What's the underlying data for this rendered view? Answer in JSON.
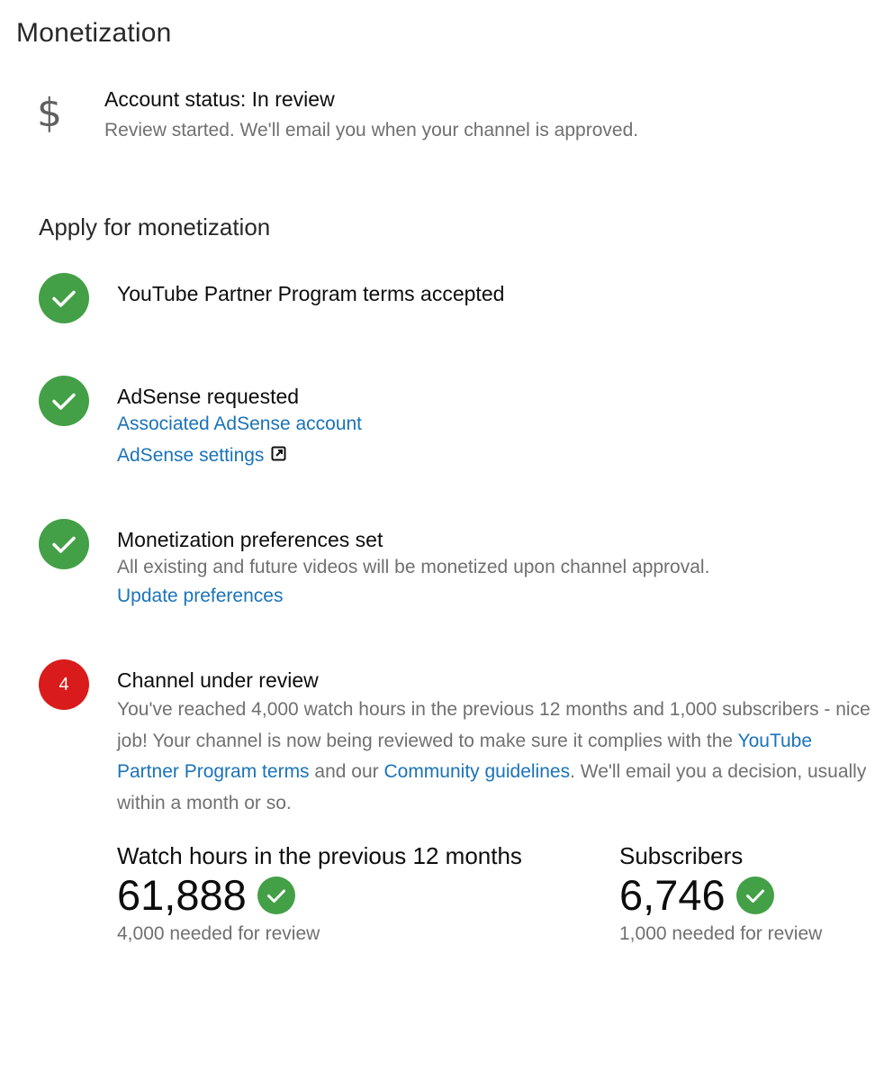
{
  "page": {
    "title": "Monetization"
  },
  "account_status": {
    "icon": "dollar-icon",
    "title": "Account status: In review",
    "subtitle": "Review started. We'll email you when your channel is approved."
  },
  "apply": {
    "title": "Apply for monetization",
    "steps": [
      {
        "status": "done",
        "title": "YouTube Partner Program terms accepted"
      },
      {
        "status": "done",
        "title": "AdSense requested",
        "links": [
          "Associated AdSense account",
          "AdSense settings"
        ]
      },
      {
        "status": "done",
        "title": "Monetization preferences set",
        "description": "All existing and future videos will be monetized upon channel approval.",
        "links": [
          "Update preferences"
        ]
      },
      {
        "status": "current",
        "number": "4",
        "title": "Channel under review",
        "description_part1": "You've reached 4,000 watch hours in the previous 12 months and 1,000 subscribers - nice job! Your channel is now being reviewed to make sure it complies with the ",
        "link_terms": "YouTube Partner Program terms",
        "description_part2": " and our ",
        "link_guidelines": "Community guidelines",
        "description_part3": ". We'll email you a decision, usually within a month or so."
      }
    ]
  },
  "metrics": {
    "watch_hours": {
      "label": "Watch hours in the previous 12 months",
      "value": "61,888",
      "needed": "4,000 needed for review"
    },
    "subscribers": {
      "label": "Subscribers",
      "value": "6,746",
      "needed": "1,000 needed for review"
    }
  },
  "colors": {
    "check_green": "#43a047",
    "step_red": "#d91b1b",
    "link_blue": "#1a73b8",
    "secondary_text": "#707070"
  }
}
